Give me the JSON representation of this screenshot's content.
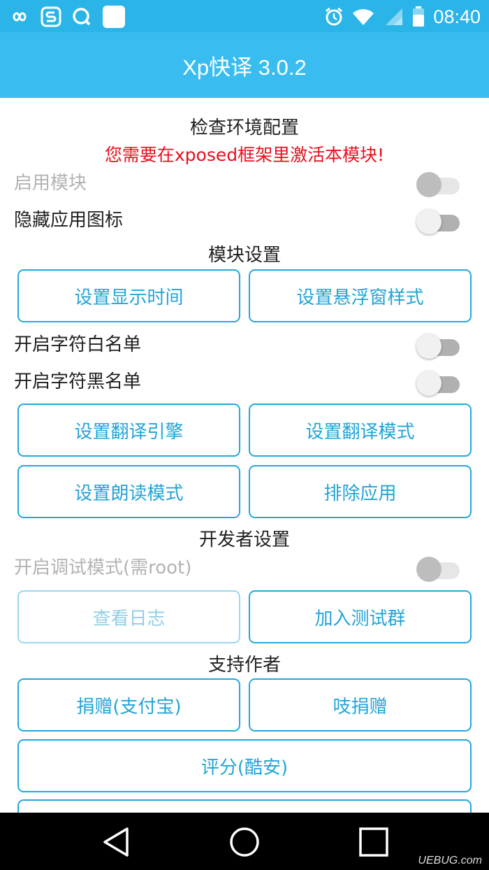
{
  "status_bar": {
    "time": "08:40",
    "left_icons": [
      "infinity-icon",
      "sogou-s-icon",
      "q-search-icon",
      "white-square-icon"
    ],
    "right_icons": [
      "alarm-icon",
      "wifi-icon",
      "signal-icon",
      "battery-icon"
    ]
  },
  "app_bar": {
    "title": "Xp快译 3.0.2"
  },
  "sections": {
    "env_title": "检查环境配置",
    "env_warning": "您需要在xposed框架里激活本模块!",
    "module_settings": "模块设置",
    "developer_settings": "开发者设置",
    "support_author": "支持作者"
  },
  "toggles": {
    "enable_module": {
      "label": "启用模块",
      "on": false,
      "enabled": false
    },
    "hide_icon": {
      "label": "隐藏应用图标",
      "on": false,
      "enabled": true
    },
    "whitelist": {
      "label": "开启字符白名单",
      "on": false,
      "enabled": true
    },
    "blacklist": {
      "label": "开启字符黑名单",
      "on": false,
      "enabled": true
    },
    "debug_mode": {
      "label": "开启调试模式(需root)",
      "on": false,
      "enabled": false
    }
  },
  "buttons": {
    "display_time": "设置显示时间",
    "float_style": "设置悬浮窗样式",
    "engine": "设置翻译引擎",
    "translate_mode": "设置翻译模式",
    "read_mode": "设置朗读模式",
    "exclude_apps": "排除应用",
    "view_log": "查看日志",
    "join_group": "加入测试群",
    "donate_alipay": "捐赠(支付宝)",
    "donate_wechat": "吱捐赠",
    "rate_coolapk": "评分(酷安)"
  },
  "nav_bar": {
    "buttons": [
      "back-icon",
      "home-icon",
      "recents-icon"
    ]
  },
  "watermark": "UEBUG.com",
  "colors": {
    "status_bar": "#2bb4e8",
    "app_bar": "#39bdf0",
    "accent": "#22a8dc",
    "warning": "#e8101f"
  }
}
